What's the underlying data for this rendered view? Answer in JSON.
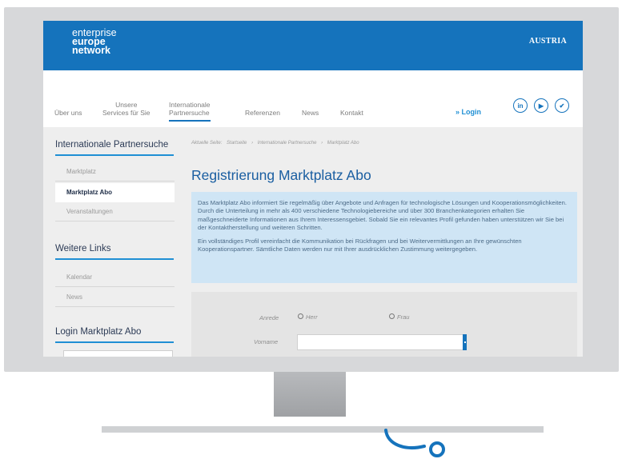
{
  "header": {
    "logo_line1": "enterprise",
    "logo_line2": "europe",
    "logo_line3": "network",
    "country": "AUSTRIA"
  },
  "nav": {
    "items": [
      {
        "line1": "",
        "line2": "Über uns"
      },
      {
        "line1": "Unsere",
        "line2": "Services für Sie"
      },
      {
        "line1": "Internationale",
        "line2": "Partnersuche"
      },
      {
        "line1": "",
        "line2": "Referenzen"
      },
      {
        "line1": "",
        "line2": "News"
      },
      {
        "line1": "",
        "line2": "Kontakt"
      }
    ],
    "login": "» Login",
    "social": [
      "in",
      "▶",
      "✔"
    ]
  },
  "sidebar": {
    "title": "Internationale Partnersuche",
    "items": [
      "Marktplatz",
      "Marktplatz Abo",
      "Veranstaltungen"
    ],
    "links_title": "Weitere Links",
    "links": [
      "Kalendar",
      "News"
    ],
    "login_title": "Login Marktplatz Abo"
  },
  "breadcrumb": [
    "Aktuelle Seite:",
    "Startseite",
    "›",
    "Internationale Partnersuche",
    "›",
    "Marktplatz Abo"
  ],
  "page_title": "Registrierung Marktplatz Abo",
  "info": {
    "p1": "Das Marktplatz Abo informiert Sie regelmäßig über Angebote und Anfragen für technologische Lösungen und Kooperationsmöglichkeiten. Durch die Unterteilung in mehr als 400 verschiedene Technologiebereiche und über 300 Branchenkategorien erhalten Sie maßgeschneiderte Informationen aus Ihrem Interessensgebiet. Sobald Sie ein relevantes Profil gefunden haben unterstützen wir Sie bei der Kontaktherstellung und weiteren Schritten.",
    "p2": "Ein vollständiges Profil vereinfacht die Kommunikation bei Rückfragen und bei Weitervermittlungen an Ihre gewünschten Kooperationspartner. Sämtliche Daten werden nur mit Ihrer ausdrücklichen Zustimmung weitergegeben."
  },
  "form": {
    "anrede_label": "Anrede",
    "option_herr": "Herr",
    "option_frau": "Frau",
    "vorname_label": "Vorname",
    "vorname_value": ""
  },
  "colors": {
    "brand_blue": "#1573bc",
    "accent_blue": "#1f8fd4",
    "info_bg": "#cfe5f5"
  }
}
